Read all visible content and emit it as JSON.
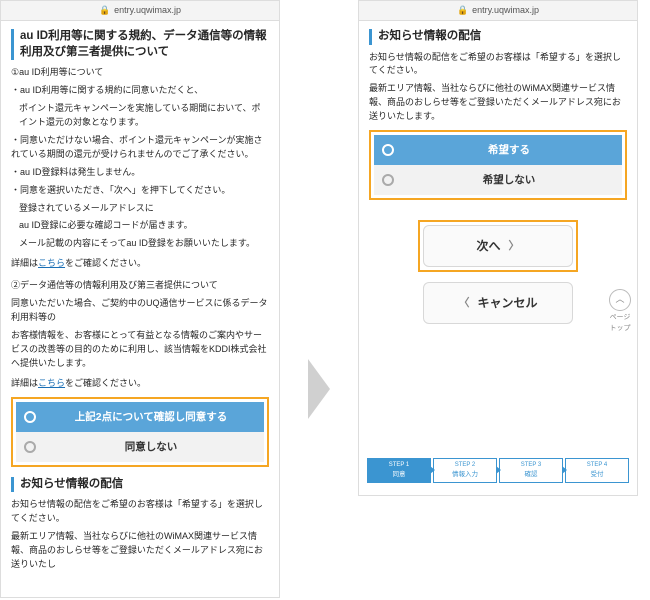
{
  "url": "entry.uqwimax.jp",
  "left": {
    "title": "au ID利用等に関する規約、データ通信等の情報利用及び第三者提供について",
    "h1": "①au ID利用等について",
    "b1": "・au ID利用等に関する規約に同意いただくと、",
    "b2": "ポイント還元キャンペーンを実施している期間において、ポイント還元の対象となります。",
    "b3": "・同意いただけない場合、ポイント還元キャンペーンが実施されている期間の還元が受けられませんのでご了承ください。",
    "b4": "・au ID登録料は発生しません。",
    "b5": "・同意を選択いただき、「次へ」を押下してください。",
    "b6": "登録されているメールアドレスに",
    "b7": "au ID登録に必要な確認コードが届きます。",
    "b8": "メール記載の内容にそってau ID登録をお願いいたします。",
    "detailPre": "詳細は",
    "detailLink": "こちら",
    "detailPost": "をご確認ください。",
    "h2": "②データ通信等の情報利用及び第三者提供について",
    "c1": "同意いただいた場合、ご契約中のUQ通信サービスに係るデータ利用料等の",
    "c2": "お客様情報を、お客様にとって有益となる情報のご案内やサービスの改善等の目的のために利用し、該当情報をKDDI株式会社へ提供いたします。",
    "optYes": "上記2点について確認し同意する",
    "optNo": "同意しない",
    "sect2": "お知らせ情報の配信",
    "d1": "お知らせ情報の配信をご希望のお客様は「希望する」を選択してください。",
    "d2": "最新エリア情報、当社ならびに他社のWiMAX関連サービス情報、商品のおしらせ等をご登録いただくメールアドレス宛にお送りいたし"
  },
  "right": {
    "title": "お知らせ情報の配信",
    "p1": "お知らせ情報の配信をご希望のお客様は「希望する」を選択してください。",
    "p2": "最新エリア情報、当社ならびに他社のWiMAX関連サービス情報、商品のおしらせ等をご登録いただくメールアドレス宛にお送りいたします。",
    "optYes": "希望する",
    "optNo": "希望しない",
    "next": "次へ",
    "cancel": "キャンセル",
    "pagetop": "ページ\nトップ",
    "steps": [
      {
        "t": "STEP 1",
        "l": "同意"
      },
      {
        "t": "STEP 2",
        "l": "情報入力"
      },
      {
        "t": "STEP 3",
        "l": "確認"
      },
      {
        "t": "STEP 4",
        "l": "受付"
      }
    ]
  }
}
